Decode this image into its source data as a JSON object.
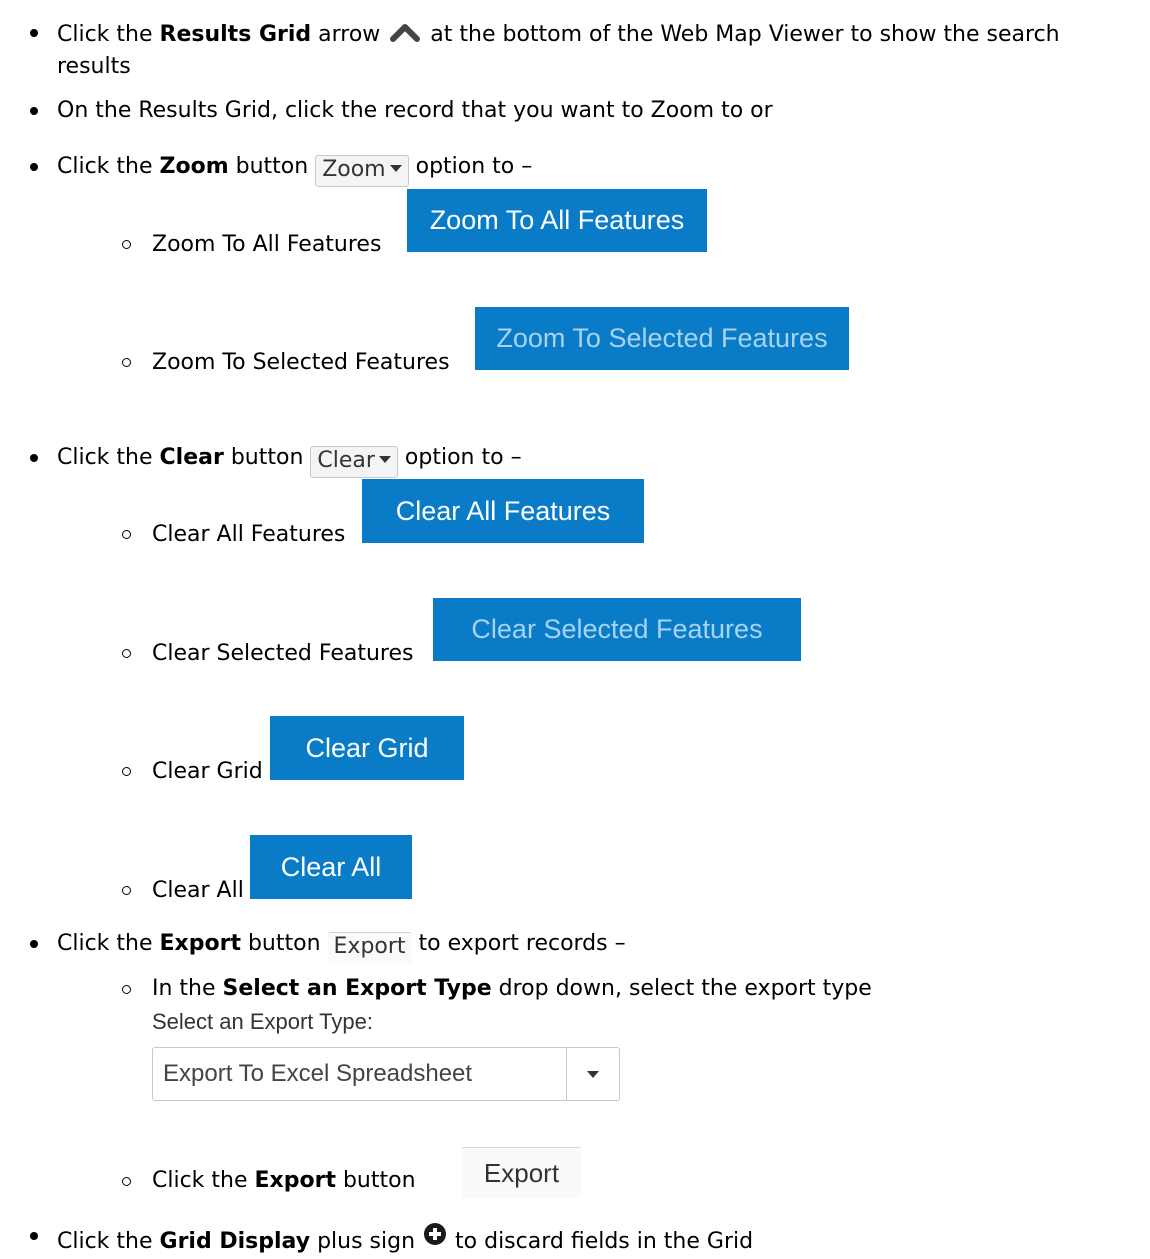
{
  "items": {
    "i1": {
      "pre": "Click the ",
      "bold": "Results Grid",
      "post1": " arrow ",
      "post2": " at the bottom of the Web Map Viewer to show the search",
      "cont": "results"
    },
    "i2": {
      "text": "On the Results Grid, click the record that you want to Zoom to or"
    },
    "i3": {
      "pre": "Click the ",
      "bold": "Zoom",
      "post1": " button ",
      "btn": "Zoom",
      "post2": " option to –"
    },
    "i3a": {
      "text": "Zoom To All Features ",
      "btn": "Zoom To All Features"
    },
    "i3b": {
      "text": "Zoom To Selected Features ",
      "btn": "Zoom To Selected Features"
    },
    "i4": {
      "pre": "Click the ",
      "bold": "Clear",
      "post1": " button ",
      "btn": "Clear",
      "post2": " option to –"
    },
    "i4a": {
      "text": "Clear All Features ",
      "btn": "Clear All Features"
    },
    "i4b": {
      "text": "Clear Selected Features ",
      "btn": "Clear Selected Features"
    },
    "i4c": {
      "text": "Clear Grid ",
      "btn": "Clear Grid"
    },
    "i4d": {
      "text": "Clear All ",
      "btn": "Clear All"
    },
    "i5": {
      "pre": "Click the ",
      "bold": "Export",
      "post1": " button ",
      "btn": "Export",
      "post2": " to export records –"
    },
    "i5a": {
      "pre": "In the ",
      "bold": "Select an Export Type",
      "post": " drop down, select the export type",
      "label": "Select an Export Type:",
      "value": "Export To Excel Spreadsheet"
    },
    "i5b": {
      "pre": "Click the ",
      "bold": "Export",
      "post": " button ",
      "btn": "Export"
    },
    "i6": {
      "pre": "Click the ",
      "bold": "Grid Display",
      "post1": " plus sign ",
      "post2": " to discard fields in the Grid"
    }
  },
  "icons": {
    "chevron_up": "chevron-up-icon",
    "caret_down": "caret-down-icon",
    "plus_circle": "plus-circle-icon"
  },
  "colors": {
    "button_blue": "#0a7cc7",
    "faded_text": "#a6d3ef"
  }
}
